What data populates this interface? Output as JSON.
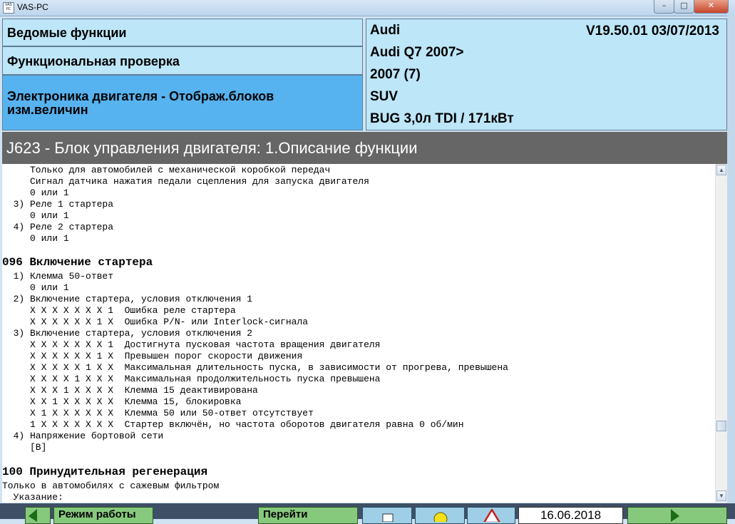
{
  "window": {
    "title": "VAS-PC",
    "icon_text": "VAS PC",
    "min_label": "–",
    "max_label": "□",
    "close_label": "✕"
  },
  "header": {
    "left_rows": [
      "Ведомые функции",
      "Функциональная проверка",
      "Электроника двигателя - Отображ.блоков",
      "изм.величин"
    ],
    "vehicle": {
      "brand": "Audi",
      "version": "V19.50.01 03/07/2013",
      "model": "Audi Q7 2007>",
      "year": "2007 (7)",
      "body": "SUV",
      "engine": "BUG 3,0л TDI / 171кВт"
    }
  },
  "section_title": "J623 - Блок управления двигателя: 1.Описание функции",
  "content_lines": [
    "     Только для автомобилей с механической коробкой передач",
    "     Сигнал датчика нажатия педали сцепления для запуска двигателя",
    "     0 или 1",
    "  3) Реле 1 стартера",
    "     0 или 1",
    "  4) Реле 2 стартера",
    "     0 или 1",
    "096 Включение стартера",
    "  1) Клемма 50-ответ",
    "     0 или 1",
    "  2) Включение стартера, условия отключения 1",
    "     X X X X X X X 1  Ошибка реле стартера",
    "     X X X X X X 1 X  Ошибка P/N- или Interlock-сигнала",
    "  3) Включение стартера, условия отключения 2",
    "     X X X X X X X 1  Достигнута пусковая частота вращения двигателя",
    "     X X X X X X 1 X  Превышен порог скорости движения",
    "     X X X X X 1 X X  Максимальная длительность пуска, в зависимости от прогрева, превышена",
    "     X X X X 1 X X X  Максимальная продолжительность пуска превышена",
    "     X X X 1 X X X X  Клемма 15 деактивирована",
    "     X X 1 X X X X X  Клемма 15, блокировка",
    "     X 1 X X X X X X  Клемма 50 или 50-ответ отсутствует",
    "     1 X X X X X X X  Стартер включён, но частота оборотов двигателя равна 0 об/мин",
    "  4) Напряжение бортовой сети",
    "     [В]",
    "100 Принудительная регенерация",
    "Только в автомобилях с сажевым фильтром",
    "  Указание:"
  ],
  "toolbar": {
    "back_icon": "arrow-left-icon",
    "mode_label": "Режим работы",
    "goto_label": "Перейти",
    "print_icon": "printer-icon",
    "help_icon": "help-icon",
    "warning_icon": "warning-icon",
    "date": "16.06.2018",
    "next_icon": "arrow-right-icon"
  },
  "colors": {
    "panel": "#bde6f8",
    "panel_active": "#56b3ef",
    "section_bar": "#666666",
    "toolbar": "#3f4f66",
    "button_green": "#86c97c",
    "button_blue": "#9ecfe6"
  }
}
